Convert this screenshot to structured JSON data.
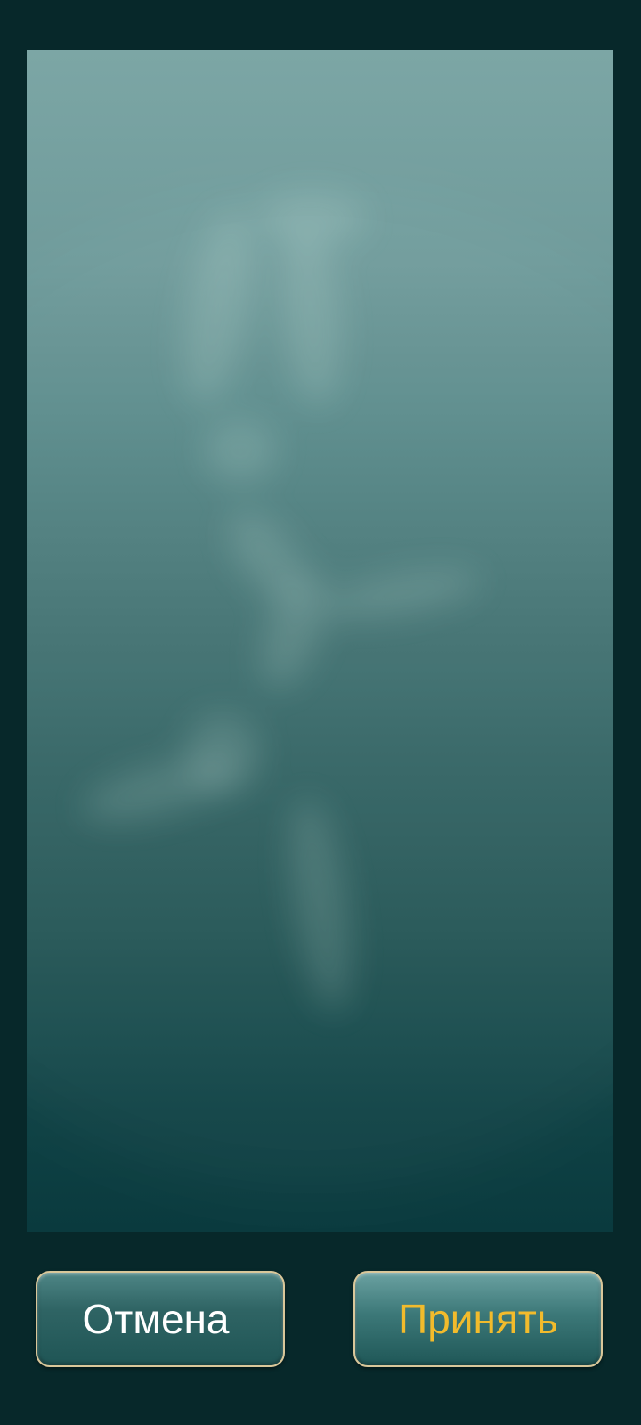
{
  "dialog": {
    "cancel_label": "Отмена",
    "accept_label": "Принять"
  },
  "colors": {
    "background": "#07282a",
    "preview_top": "#7ca6a5",
    "preview_bottom": "#0a3a3e",
    "button_border": "#d9c79a",
    "accept_text": "#f2bb2c",
    "cancel_text": "#ffffff"
  }
}
